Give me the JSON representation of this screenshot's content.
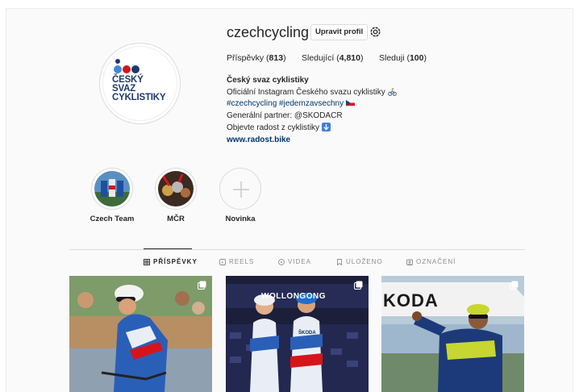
{
  "profile": {
    "username": "czechcycling",
    "edit_label": "Upravit profil",
    "logo_lines": [
      "ČESKÝ",
      "SVAZ",
      "CYKLISTIKY"
    ]
  },
  "stats": {
    "posts_label": "Příspěvky",
    "posts_count": "813",
    "followers_label": "Sledující",
    "followers_count": "4,810",
    "following_label": "Sleduji",
    "following_count": "100"
  },
  "bio": {
    "name": "Český svaz cyklistiky",
    "line1": "Oficiální Instagram Českého svazu cyklistiky",
    "hashtags": "#czechcycling #jedemzavsechny",
    "partner": "Generální partner: @SKODACR",
    "line4": "Objevte radost z cyklistiky",
    "website": "www.radost.bike"
  },
  "highlights": [
    {
      "label": "Czech Team",
      "icon": "team-photo"
    },
    {
      "label": "MČR",
      "icon": "medals-photo"
    },
    {
      "label": "Novinka",
      "icon": "plus-icon"
    }
  ],
  "tabs": [
    {
      "label": "PŘÍSPĚVKY",
      "icon": "grid-icon",
      "active": true
    },
    {
      "label": "REELS",
      "icon": "reels-icon",
      "active": false
    },
    {
      "label": "VIDEA",
      "icon": "video-icon",
      "active": false
    },
    {
      "label": "ULOŽENO",
      "icon": "bookmark-icon",
      "active": false
    },
    {
      "label": "OZNAČENÍ",
      "icon": "tag-icon",
      "active": false
    }
  ],
  "posts": [
    {
      "icon": "carousel-icon",
      "subject": "cyclist-racing"
    },
    {
      "icon": "carousel-icon",
      "subject": "two-riders-podium",
      "banner_text": "WOLLONGONG",
      "jersey_text": "ŠKODA"
    },
    {
      "icon": "carousel-icon",
      "subject": "cyclist-celebrating",
      "banner_text": "KODA"
    }
  ],
  "colors": {
    "link": "#00376b",
    "logo_blue": "#1d3a6e",
    "logo_red": "#d7141a",
    "logo_light_blue": "#3c8ad6"
  }
}
